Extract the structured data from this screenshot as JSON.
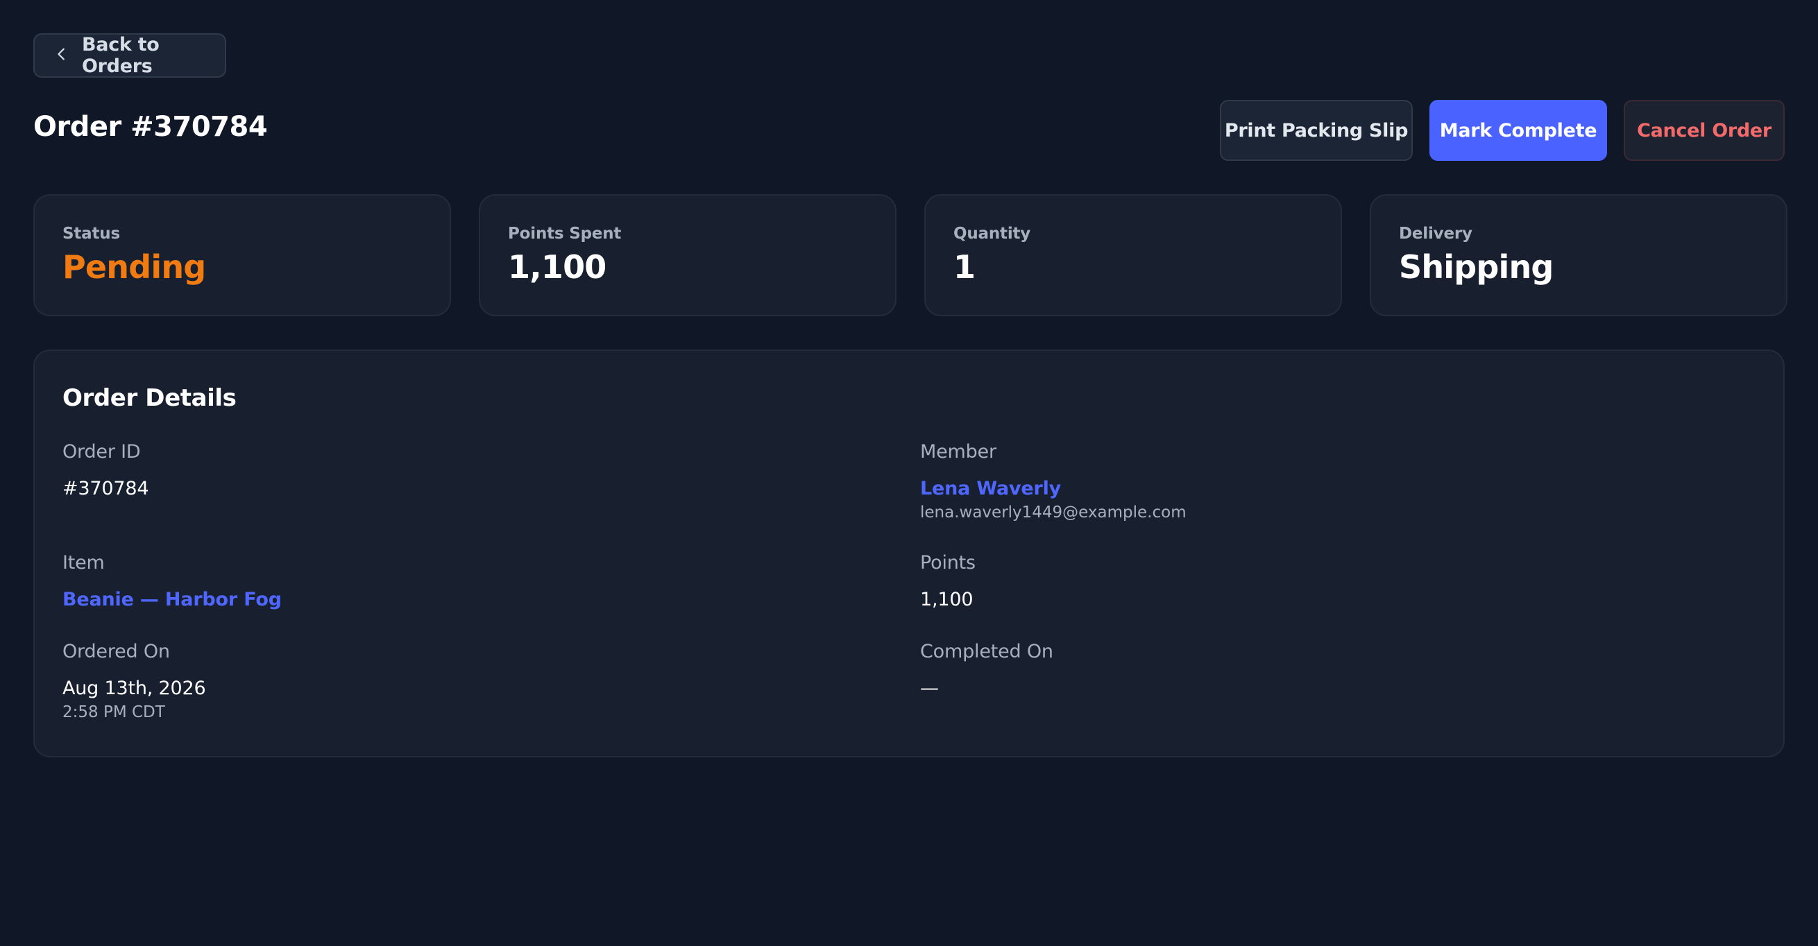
{
  "nav": {
    "back_label": "Back to Orders"
  },
  "header": {
    "title": "Order #370784"
  },
  "actions": {
    "print_label": "Print Packing Slip",
    "complete_label": "Mark Complete",
    "cancel_label": "Cancel Order"
  },
  "stats": [
    {
      "label": "Status",
      "value": "Pending"
    },
    {
      "label": "Points Spent",
      "value": "1,100"
    },
    {
      "label": "Quantity",
      "value": "1"
    },
    {
      "label": "Delivery",
      "value": "Shipping"
    }
  ],
  "details": {
    "heading": "Order Details",
    "order_id": {
      "label": "Order ID",
      "value": "#370784"
    },
    "member": {
      "label": "Member",
      "name": "Lena Waverly",
      "email": "lena.waverly1449@example.com"
    },
    "item": {
      "label": "Item",
      "value": "Beanie — Harbor Fog"
    },
    "points": {
      "label": "Points",
      "value": "1,100"
    },
    "ordered_on": {
      "label": "Ordered On",
      "date": "Aug 13th, 2026",
      "time": "2:58 PM CDT"
    },
    "completed_on": {
      "label": "Completed On",
      "value": "—"
    }
  },
  "colors": {
    "background": "#101828",
    "card": "#182030",
    "accent": "#4a62ff",
    "pending": "#f07b12",
    "danger": "#f26a6a"
  },
  "icons": {
    "back": "chevron-left-icon"
  }
}
